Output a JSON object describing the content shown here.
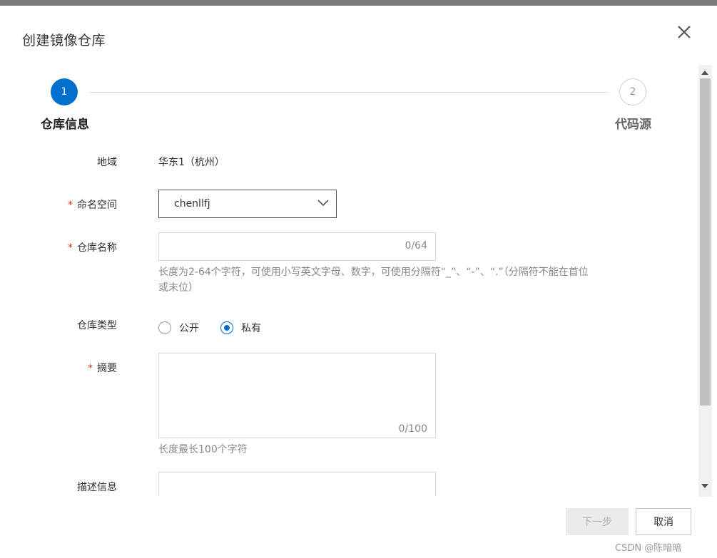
{
  "dialog": {
    "title": "创建镜像仓库",
    "close_icon": "close-icon"
  },
  "steps": [
    {
      "number": "1",
      "label": "仓库信息",
      "state": "active"
    },
    {
      "number": "2",
      "label": "代码源",
      "state": "inactive"
    }
  ],
  "form": {
    "region": {
      "label": "地域",
      "value": "华东1（杭州）"
    },
    "namespace": {
      "label": "命名空间",
      "required": "*",
      "value": "chenllfj"
    },
    "repo_name": {
      "label": "仓库名称",
      "required": "*",
      "value": "",
      "counter": "0/64",
      "hint_line1": "长度为2-64个字符，可使用小写英文字母、数字，可使用分隔符“_”、“-”、“.”（分隔符不能在首位",
      "hint_line2": "或末位）"
    },
    "repo_type": {
      "label": "仓库类型",
      "options": [
        "公开",
        "私有"
      ],
      "selected": "私有"
    },
    "summary": {
      "label": "摘要",
      "required": "*",
      "value": "",
      "counter": "0/100",
      "hint": "长度最长100个字符"
    },
    "description": {
      "label": "描述信息"
    }
  },
  "footer": {
    "next_label": "下一步",
    "cancel_label": "取消"
  },
  "watermark": "CSDN @陈暗暗",
  "colors": {
    "accent": "#0070cc",
    "required": "#d93026"
  }
}
